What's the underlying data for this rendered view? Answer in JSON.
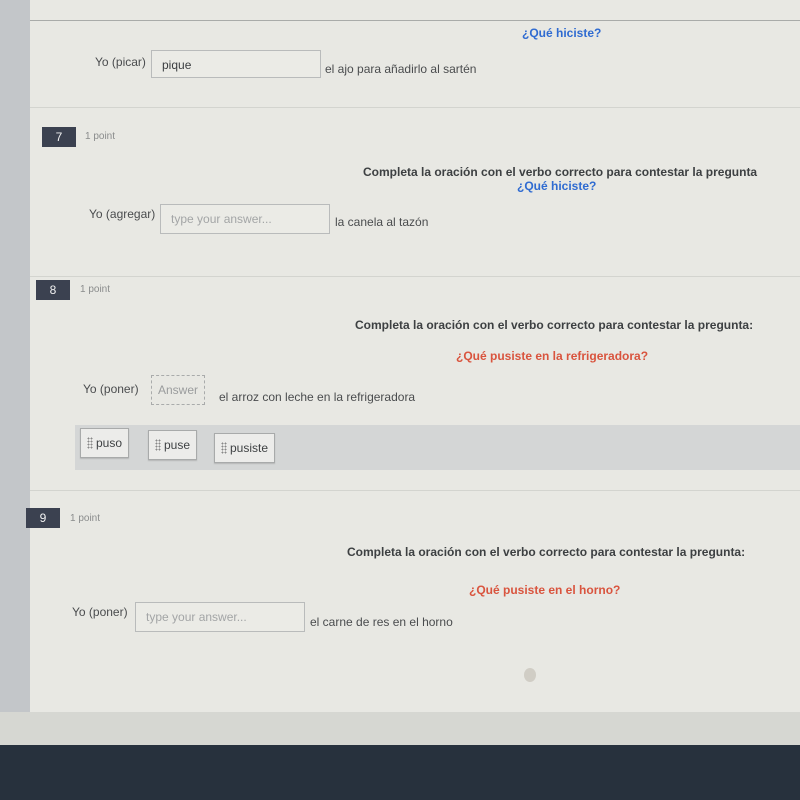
{
  "questions": [
    {
      "number": "",
      "points": "",
      "prompt": "",
      "question": "¿Qué hiciste?",
      "subject": "Yo (picar)",
      "answer_value": "pique",
      "answer_placeholder": "",
      "rest": "el ajo para añadirlo al sartén"
    },
    {
      "number": "7",
      "points": "1 point",
      "prompt": "Completa la oración con el verbo correcto para contestar la pregunta",
      "question": "¿Qué hiciste?",
      "subject": "Yo (agregar)",
      "answer_value": "",
      "answer_placeholder": "type your answer...",
      "rest": "la canela al tazón"
    },
    {
      "number": "8",
      "points": "1 point",
      "prompt": "Completa la oración con el verbo correcto para contestar la pregunta:",
      "question": "¿Qué pusiste en la refrigeradora?",
      "subject": "Yo (poner)",
      "dropzone_label": "Answer",
      "rest": "el arroz con leche en la refrigeradora",
      "choices": [
        "puso",
        "puse",
        "pusiste"
      ]
    },
    {
      "number": "9",
      "points": "1 point",
      "prompt": "Completa la oración con el verbo correcto para contestar la pregunta:",
      "question": "¿Qué pusiste en el horno?",
      "subject": "Yo (poner)",
      "answer_value": "",
      "answer_placeholder": "type your answer...",
      "rest": "el carne de res en el horno"
    }
  ],
  "colors": {
    "question_blue": "#2f6bd1",
    "question_red": "#d9543e",
    "number_badge": "#3b4150"
  },
  "icons": {
    "drag_handle": "drag-handle-icon"
  }
}
